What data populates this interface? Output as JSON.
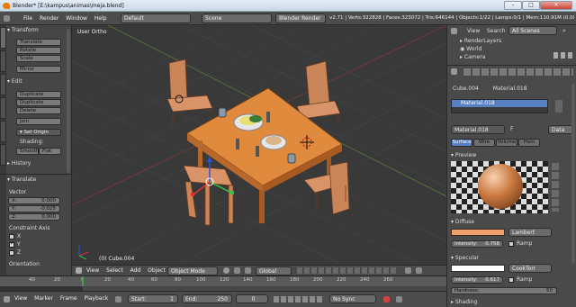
{
  "window": {
    "title": "Blender* [E:\\kampus\\animas\\meja.blend]",
    "controls": [
      "–",
      "□",
      "✕"
    ]
  },
  "infobar": {
    "menus": [
      "File",
      "Render",
      "Window",
      "Help"
    ],
    "screen_layout": "Default",
    "scene": "Scene",
    "render_engine": "Blender Render",
    "stats": "v2.71 | Verts:322828 | Faces:323072 | Tris:646144 | Objects:1/22 | Lamps:0/1 | Mem:110.91M (0.00M) | Cu"
  },
  "toolshelf": {
    "tabs": [
      "Tools",
      "Create",
      "Relations",
      "Animation",
      "Physics",
      "Grease Pencil"
    ],
    "transform_header": "Transform",
    "transform_buttons": [
      "Translate",
      "Rotate",
      "Scale",
      "Mirror"
    ],
    "edit_header": "Edit",
    "edit_buttons": [
      "Duplicate",
      "Duplicate Linked",
      "Delete",
      "Join"
    ],
    "set_origin": "Set Origin",
    "shading_label": "Shading:",
    "shading_buttons": [
      "Smooth",
      "Flat"
    ],
    "history_header": "History",
    "operator_header": "Translate",
    "vector_label": "Vector",
    "vector_fields": [
      "X:",
      "Y:",
      "Z:"
    ],
    "vector_values": [
      "0.000",
      "-0.025",
      "0.000"
    ],
    "constraint_label": "Constraint Axis",
    "constraint_axes": [
      "X",
      "Y",
      "Z"
    ],
    "constraint_checked": [
      false,
      true,
      false
    ],
    "orientation_label": "Orientation"
  },
  "viewport": {
    "view_label": "User Ortho",
    "object_label": "(0) Cube.004"
  },
  "viewport_header": {
    "menus": [
      "View",
      "Select",
      "Add",
      "Object"
    ],
    "mode": "Object Mode",
    "pivot": "Global"
  },
  "outliner": {
    "menus": [
      "View",
      "Search"
    ],
    "filter": "All Scenes",
    "items": [
      "RenderLayers",
      "World",
      "Camera"
    ]
  },
  "properties": {
    "breadcrumb_object": "Cube.004",
    "breadcrumb_material": "Material.018",
    "slot_name": "Material.018",
    "material_field": "Material.018",
    "material_users": "F",
    "data_link": "Data",
    "tabs": [
      "Surface",
      "Wire",
      "Volume",
      "Halo"
    ],
    "active_tab": 0,
    "preview_header": "Preview",
    "diffuse_header": "Diffuse",
    "diffuse_color": "#f1a26b",
    "diffuse_shader": "Lambert",
    "intensity_label": "Intensity:",
    "diffuse_intensity": "0.758",
    "ramp_label": "Ramp",
    "specular_header": "Specular",
    "specular_color": "#ffffff",
    "specular_shader": "CookTorr",
    "specular_intensity": "0.617",
    "hardness_label": "Hardness:",
    "hardness_value": "50",
    "shading_header": "Shading"
  },
  "timeline": {
    "ruler_ticks": [
      "40",
      "20",
      "0",
      "20",
      "40",
      "60",
      "80",
      "100",
      "120",
      "140",
      "160",
      "180",
      "200",
      "220",
      "240",
      "260"
    ],
    "menus": [
      "View",
      "Marker",
      "Frame",
      "Playback"
    ],
    "start_label": "Start:",
    "start_value": "1",
    "end_label": "End:",
    "end_value": "250",
    "current_frame": "0",
    "sync": "No Sync"
  }
}
